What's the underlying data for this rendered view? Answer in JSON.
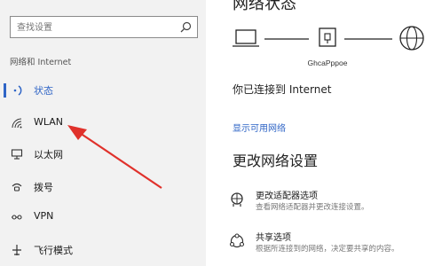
{
  "sidebar": {
    "search_placeholder": "查找设置",
    "section_title": "网络和 Internet",
    "items": [
      {
        "label": "状态",
        "icon": "status-icon",
        "active": true
      },
      {
        "label": "WLAN",
        "icon": "wifi-icon"
      },
      {
        "label": "以太网",
        "icon": "ethernet-icon"
      },
      {
        "label": "拨号",
        "icon": "dialup-icon"
      },
      {
        "label": "VPN",
        "icon": "vpn-icon"
      },
      {
        "label": "飞行模式",
        "icon": "airplane-icon"
      }
    ]
  },
  "main": {
    "heading": "网络状态",
    "diagram_label": "GhcaPppoe",
    "connected_text": "你已连接到 Internet",
    "show_networks_link": "显示可用网络",
    "change_settings_heading": "更改网络设置",
    "options": [
      {
        "title": "更改适配器选项",
        "desc": "查看网络适配器并更改连接设置。",
        "icon": "adapter-icon"
      },
      {
        "title": "共享选项",
        "desc": "根据所连接到的网络，决定要共享的内容。",
        "icon": "sharing-icon"
      }
    ]
  },
  "colors": {
    "accent": "#2f65c6",
    "arrow": "#e0312b",
    "sidebar_bg": "#f2f2f2"
  }
}
